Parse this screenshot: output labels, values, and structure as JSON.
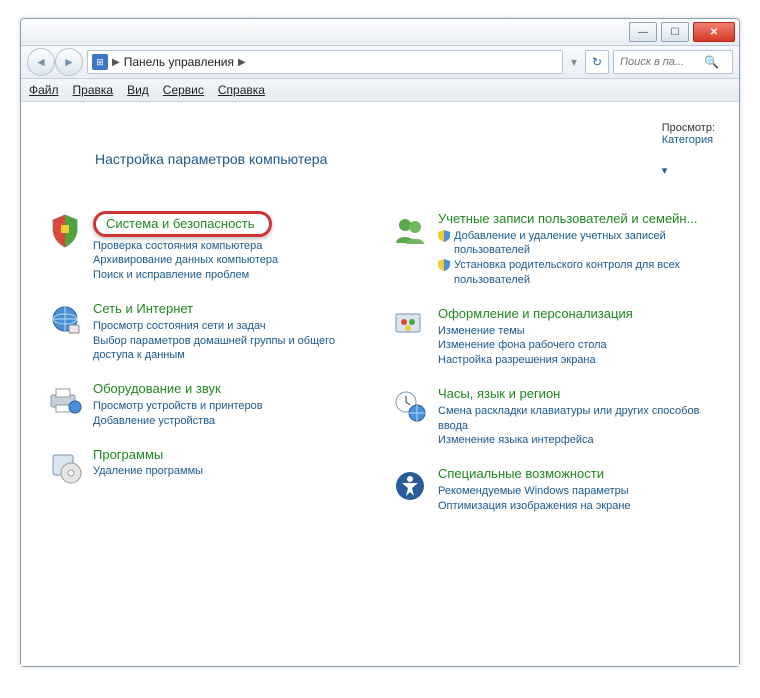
{
  "titlebar": {},
  "address": {
    "title": "Панель управления"
  },
  "search": {
    "placeholder": "Поиск в па..."
  },
  "menu": {
    "file": "Файл",
    "edit": "Правка",
    "view": "Вид",
    "tools": "Сервис",
    "help": "Справка"
  },
  "header": {
    "title": "Настройка параметров компьютера",
    "viewLabel": "Просмотр:",
    "viewValue": "Категория"
  },
  "cats": {
    "system": {
      "title": "Система и безопасность",
      "links": [
        "Проверка состояния компьютера",
        "Архивирование данных компьютера",
        "Поиск и исправление проблем"
      ]
    },
    "network": {
      "title": "Сеть и Интернет",
      "links": [
        "Просмотр состояния сети и задач",
        "Выбор параметров домашней группы и общего доступа к данным"
      ]
    },
    "hardware": {
      "title": "Оборудование и звук",
      "links": [
        "Просмотр устройств и принтеров",
        "Добавление устройства"
      ]
    },
    "programs": {
      "title": "Программы",
      "links": [
        "Удаление программы"
      ]
    },
    "users": {
      "title": "Учетные записи пользователей и семейн...",
      "links": [
        "Добавление и удаление учетных записей пользователей",
        "Установка родительского контроля для всех пользователей"
      ]
    },
    "appearance": {
      "title": "Оформление и персонализация",
      "links": [
        "Изменение темы",
        "Изменение фона рабочего стола",
        "Настройка разрешения экрана"
      ]
    },
    "clock": {
      "title": "Часы, язык и регион",
      "links": [
        "Смена раскладки клавиатуры или других способов ввода",
        "Изменение языка интерфейса"
      ]
    },
    "ease": {
      "title": "Специальные возможности",
      "links": [
        "Рекомендуемые Windows параметры",
        "Оптимизация изображения на экране"
      ]
    }
  }
}
